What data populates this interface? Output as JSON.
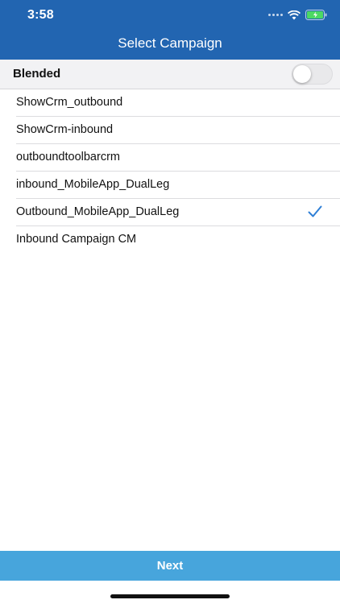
{
  "status_bar": {
    "time": "3:58"
  },
  "header": {
    "title": "Select Campaign"
  },
  "blended": {
    "label": "Blended",
    "enabled": false
  },
  "campaigns": [
    {
      "name": "ShowCrm_outbound",
      "selected": false
    },
    {
      "name": "ShowCrm-inbound",
      "selected": false
    },
    {
      "name": "outboundtoolbarcrm",
      "selected": false
    },
    {
      "name": "inbound_MobileApp_DualLeg",
      "selected": false
    },
    {
      "name": "Outbound_MobileApp_DualLeg",
      "selected": true
    },
    {
      "name": "Inbound Campaign CM",
      "selected": false
    }
  ],
  "footer": {
    "next_label": "Next"
  },
  "colors": {
    "header": "#2265B1",
    "next_button": "#47A5DC",
    "checkmark": "#2E7FD6"
  }
}
